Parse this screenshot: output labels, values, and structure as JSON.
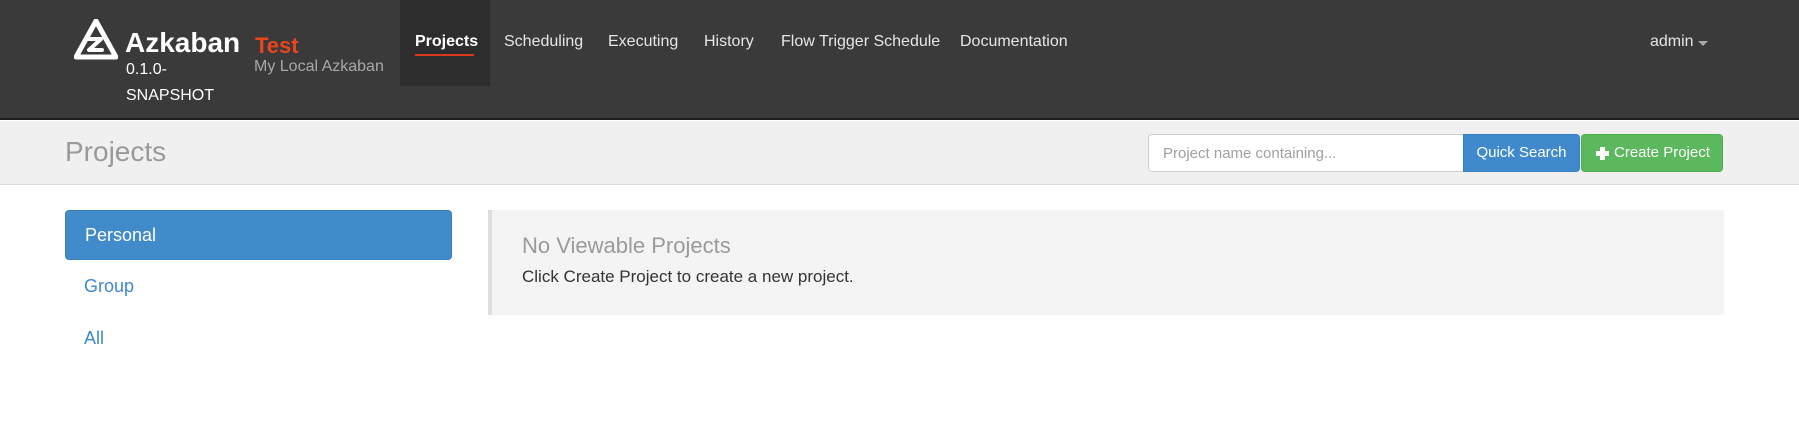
{
  "brand": {
    "logo_icon": "azkaban-logo-icon",
    "name": "Azkaban",
    "version": "0.1.0-SNAPSHOT",
    "env_name": "Test",
    "env_subtitle": "My Local Azkaban"
  },
  "nav": {
    "items": [
      {
        "label": "Projects",
        "active": true
      },
      {
        "label": "Scheduling",
        "active": false
      },
      {
        "label": "Executing",
        "active": false
      },
      {
        "label": "History",
        "active": false
      },
      {
        "label": "Flow Trigger Schedule",
        "active": false
      },
      {
        "label": "Documentation",
        "active": false
      }
    ],
    "user": "admin",
    "user_caret_icon": "caret-down-icon"
  },
  "header": {
    "title": "Projects",
    "search_placeholder": "Project name containing...",
    "search_value": "",
    "search_button": "Quick Search",
    "create_button": "Create Project",
    "create_icon": "plus-icon"
  },
  "sidebar": {
    "items": [
      {
        "label": "Personal",
        "active": true
      },
      {
        "label": "Group",
        "active": false
      },
      {
        "label": "All",
        "active": false
      }
    ]
  },
  "main": {
    "empty_title": "No Viewable Projects",
    "empty_text": "Click Create Project to create a new project."
  },
  "colors": {
    "navbar_bg": "#3a3a3a",
    "env_accent": "#e8451b",
    "primary": "#428bca",
    "success": "#5cb85c"
  }
}
